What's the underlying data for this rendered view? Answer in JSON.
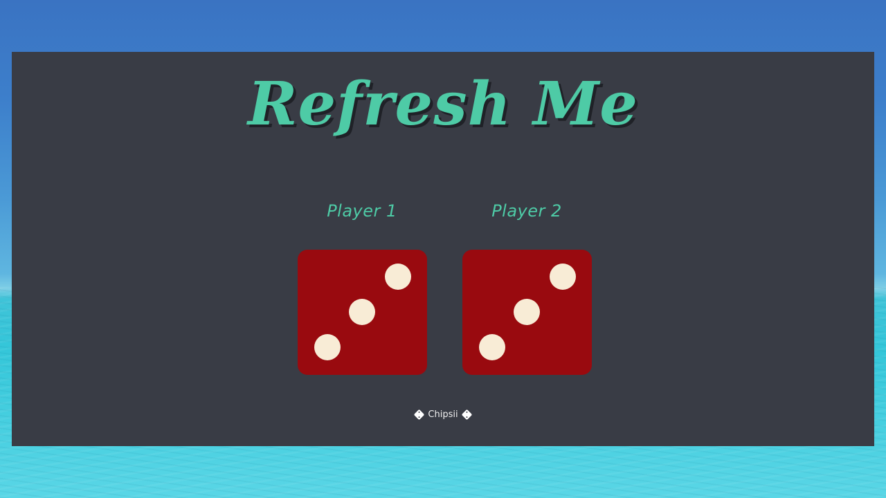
{
  "title": "Refresh Me",
  "players": [
    {
      "label": "Player 1",
      "die_value": 3
    },
    {
      "label": "Player 2",
      "die_value": 3
    }
  ],
  "footer": {
    "credit": "Chipsii",
    "icon_left": "dice-icon",
    "icon_right": "dice-icon"
  },
  "colors": {
    "panel": "#393c45",
    "accent": "#4ecba6",
    "die": "#990a0f",
    "pip": "#f8ecd6"
  }
}
